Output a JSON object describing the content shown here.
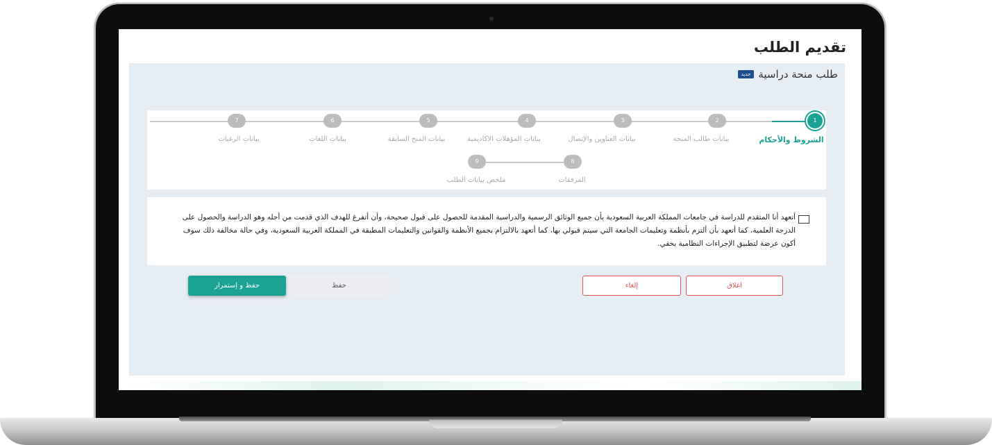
{
  "page": {
    "title": "تقديم الطلب",
    "subtitle": "طلب منحة دراسية",
    "badge": "جديد"
  },
  "steps": [
    {
      "number": "1",
      "label": "الشروط والأحكام",
      "active": true
    },
    {
      "number": "2",
      "label": "بيانات طالب المنحة",
      "active": false
    },
    {
      "number": "3",
      "label": "بيانات العناوين والإتصال",
      "active": false
    },
    {
      "number": "4",
      "label": "بيانات المؤهلات الاكاديمية",
      "active": false
    },
    {
      "number": "5",
      "label": "بيانات المنح السابقة",
      "active": false
    },
    {
      "number": "6",
      "label": "بيانات اللغات",
      "active": false
    },
    {
      "number": "7",
      "label": "بيانات الرغبات",
      "active": false
    },
    {
      "number": "8",
      "label": "المرفقات",
      "active": false
    },
    {
      "number": "9",
      "label": "ملخص بيانات الطلب",
      "active": false
    }
  ],
  "terms": {
    "text": "أتعهد أنا المتقدم للدراسة في جامعات المملكة العربية السعودية بأن جميع الوثائق الرسمية والدراسية المقدمة للحصول على قبول صحيحة، وأن أتفرغ للهدف الذي قدمت من أجله وهو الدراسة والحصول على الدرجة العلمية، كما أتعهد بأن ألتزم بأنظمة وتعليمات الجامعة التي سيتم قبولي بها، كما أتعهد بالالتزام بجميع الأنظمة والقوانين والتعليمات المطبقة في المملكة العربية السعودية، وفي حالة مخالفة ذلك سوف أكون عرضة لتطبيق الإجراءات النظامية بحقي.",
    "checked": false
  },
  "buttons": {
    "close": "اغلاق",
    "cancel": "إلغاء",
    "save": "حفظ",
    "save_continue": "حفظ و إستمرار"
  },
  "colors": {
    "accent": "#1aa394",
    "danger": "#e05656",
    "inactive": "#bdbdbd",
    "panel": "#e6edf3"
  }
}
